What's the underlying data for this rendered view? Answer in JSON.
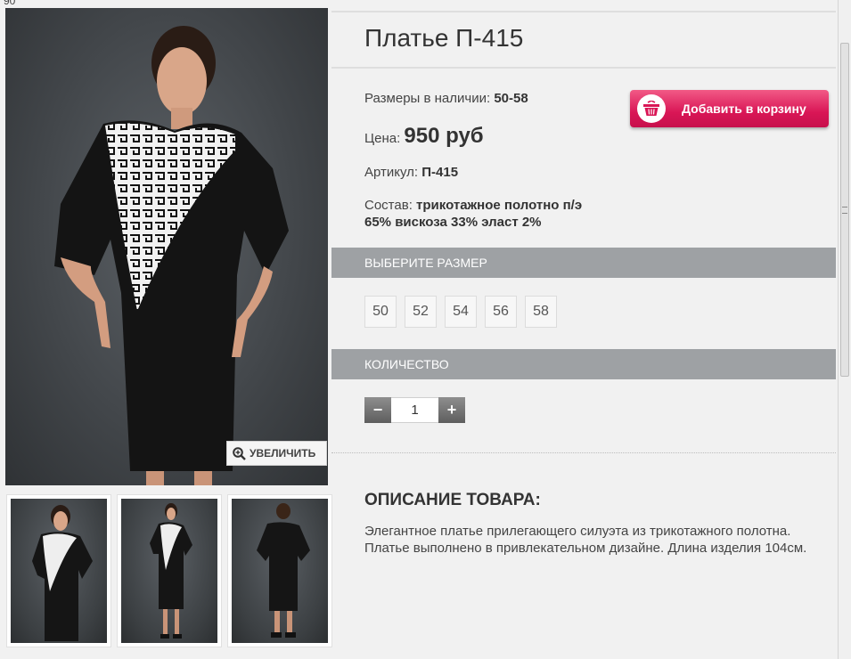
{
  "stray_text": "90",
  "product": {
    "title": "Платье П-415",
    "sizes_label": "Размеры в наличии:",
    "sizes_value": "50-58",
    "price_label": "Цена:",
    "price_value": "950 руб",
    "article_label": "Артикул:",
    "article_value": "П-415",
    "composition_label": "Состав:",
    "composition_line1": "трикотажное полотно п/э",
    "composition_line2": "65% вискоза 33% эласт 2%"
  },
  "cart_button": {
    "label": "Добавить в корзину",
    "icon": "shopping-basket-icon",
    "color": "#d91656"
  },
  "gallery": {
    "zoom_label": "УВЕЛИЧИТЬ",
    "zoom_icon": "magnifier-plus-icon",
    "thumbnails": [
      "front-view",
      "full-front-view",
      "back-view"
    ]
  },
  "size_section": {
    "header": "ВЫБЕРИТЕ РАЗМЕР",
    "sizes": [
      "50",
      "52",
      "54",
      "56",
      "58"
    ]
  },
  "quantity_section": {
    "header": "КОЛИЧЕСТВО",
    "minus_label": "−",
    "plus_label": "+",
    "value": "1"
  },
  "description": {
    "title": "ОПИСАНИЕ ТОВАРА:",
    "text": "Элегантное платье прилегающего силуэта из трикотажного полотна. Платье выполнено в привлекательном дизайне. Длина изделия 104см."
  }
}
